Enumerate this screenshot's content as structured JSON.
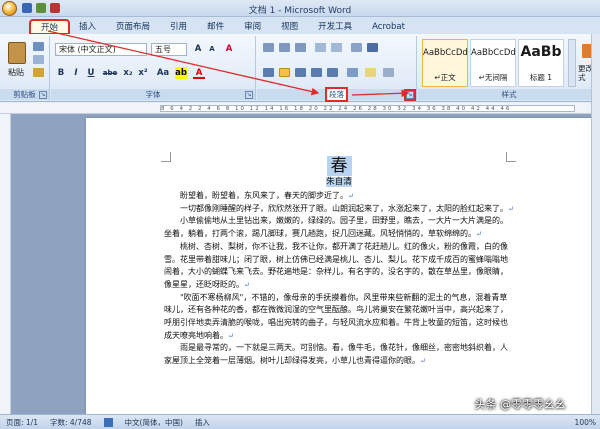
{
  "window": {
    "title": "文档 1 - Microsoft Word"
  },
  "tabs": [
    {
      "label": "开始",
      "active": true
    },
    {
      "label": "插入"
    },
    {
      "label": "页面布局"
    },
    {
      "label": "引用"
    },
    {
      "label": "邮件"
    },
    {
      "label": "审阅"
    },
    {
      "label": "视图"
    },
    {
      "label": "开发工具"
    },
    {
      "label": "Acrobat"
    }
  ],
  "ribbon": {
    "clipboard": {
      "label": "剪贴板",
      "paste_label": "粘贴"
    },
    "font": {
      "label": "字体",
      "font_name": "宋体 (中文正文)",
      "font_size": "五号",
      "grow": "A",
      "shrink": "A",
      "clear": "A",
      "bold": "B",
      "italic": "I",
      "underline": "U",
      "strike": "abe",
      "sub": "x₂",
      "sup": "x²",
      "case": "Aa",
      "color": "A"
    },
    "paragraph": {
      "label": "段落"
    },
    "styles": {
      "label": "样式",
      "items": [
        {
          "sample": "AaBbCcDd",
          "name": "↵正文",
          "selected": true
        },
        {
          "sample": "AaBbCcDd",
          "name": "↵无间隔"
        },
        {
          "sample": "AaBb",
          "name": "标题 1"
        }
      ],
      "change_label": "更改样式"
    }
  },
  "ruler": {
    "ticks": "8 6 4 2 2 4 6 8 10 12 14 16 18 20 22 24 26 28 30 32 34 36 38 40 42 44 46"
  },
  "document": {
    "title": "春",
    "author": "朱自清",
    "paragraphs": [
      "盼望着，盼望着，东风来了，春天的脚步近了。",
      "一切都像刚睡醒的样子，欣欣然张开了眼。山朗润起来了，水涨起来了，太阳的脸红起来了。",
      "小草偷偷地从土里钻出来，嫩嫩的，绿绿的。园子里，田野里，瞧去，一大片一大片满是的。坐着，躺着，打两个滚，踢几脚球，赛几趟跑，捉几回迷藏。风轻悄悄的，草软绵绵的。",
      "桃树、杏树、梨树，你不让我，我不让你，都开满了花赶趟儿。红的像火，粉的像霞，白的像雪。花里带着甜味儿；闭了眼，树上仿佛已经满是桃儿、杏儿、梨儿。花下成千成百的蜜蜂嗡嗡地闹着，大小的蝴蝶飞来飞去。野花遍地是：杂样儿，有名字的，没名字的，散在草丛里，像眼睛，像星星，还眨呀眨的。",
      "\"吹面不寒杨柳风\"，不错的，像母亲的手抚摸着你。风里带来些新翻的泥土的气息，混着青草味儿，还有各种花的香，都在微微润湿的空气里酝酿。鸟儿将巢安在繁花嫩叶当中，高兴起来了，呼朋引伴地卖弄清脆的喉咙，唱出宛转的曲子，与轻风流水应和着。牛背上牧童的短笛，这时候也成天嘹亮地响着。",
      "雨是最寻常的，一下就是三两天。可别恼。看，像牛毛，像花针，像细丝，密密地斜织着，人家屋顶上全笼着一层薄烟。树叶儿却绿得发亮，小草儿也青得逼你的眼。"
    ],
    "paragraph_mark": "↵"
  },
  "status": {
    "page": "页面: 1/1",
    "words": "字数: 4/748",
    "language": "中文(简体，中国)",
    "mode": "插入",
    "zoom": "100%"
  },
  "watermark": "头条 @零零零幺幺"
}
